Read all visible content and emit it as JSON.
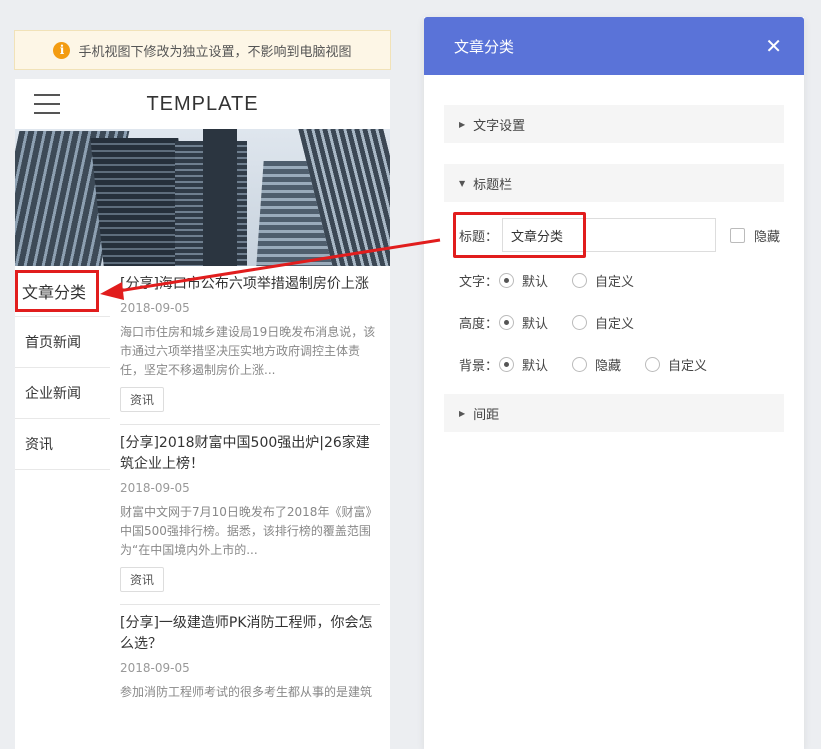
{
  "notice": {
    "icon": "info-icon",
    "text": "手机视图下修改为独立设置，不影响到电脑视图"
  },
  "phone": {
    "brand": "TEMPLATE",
    "menu_icon": "hamburger-menu-icon",
    "sidebar": [
      {
        "label": "文章分类"
      },
      {
        "label": "首页新闻"
      },
      {
        "label": "企业新闻"
      },
      {
        "label": "资讯"
      }
    ],
    "articles": [
      {
        "title": "[分享]海口市公布六项举措遏制房价上涨",
        "date": "2018-09-05",
        "summary": "海口市住房和城乡建设局19日晚发布消息说，该市通过六项举措坚决压实地方政府调控主体责任，坚定不移遏制房价上涨...",
        "tag": "资讯"
      },
      {
        "title": "[分享]2018财富中国500强出炉|26家建筑企业上榜！",
        "date": "2018-09-05",
        "summary": "财富中文网于7月10日晚发布了2018年《财富》中国500强排行榜。据悉，该排行榜的覆盖范围为“在中国境内外上市的...",
        "tag": "资讯"
      },
      {
        "title": "[分享]一级建造师PK消防工程师，你会怎么选？",
        "date": "2018-09-05",
        "summary": "参加消防工程师考试的很多考生都从事的是建筑"
      }
    ]
  },
  "panel": {
    "title": "文章分类",
    "close_icon": "close-icon",
    "sections": {
      "text_settings": "文字设置",
      "title_bar": "标题栏",
      "spacing": "间距"
    },
    "form": {
      "title_label": "标题：",
      "title_value": "文章分类",
      "hide_label": "隐藏",
      "text_label": "文字：",
      "height_label": "高度：",
      "background_label": "背景：",
      "default_option": "默认",
      "custom_option": "自定义",
      "hide_option": "隐藏"
    }
  },
  "colors": {
    "header": "#5a73d8",
    "highlight": "#e11d1d",
    "notice_bg": "#fdf6e6",
    "notice_icon": "#f39c12"
  }
}
